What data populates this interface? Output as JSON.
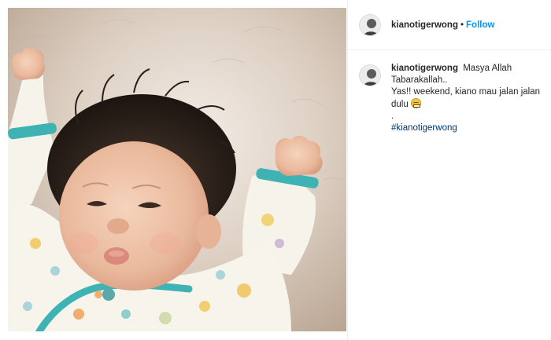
{
  "post": {
    "photo_alt": "",
    "author": "kianotigerwong",
    "separator": "•",
    "follow_label": "Follow",
    "caption": {
      "username": "kianotigerwong",
      "line1": "Masya Allah",
      "line2": "Tabarakallah..",
      "line3": "Yas!! weekend, kiano mau jalan jalan",
      "line4": "dulu",
      "emoji_icon": "grinning-face-icon",
      "line5": ".",
      "hashtag": "#kianotigerwong"
    }
  },
  "colors": {
    "follow_blue": "#0095f6",
    "hashtag_blue": "#00376b",
    "text": "#262626",
    "border": "#efefef"
  }
}
